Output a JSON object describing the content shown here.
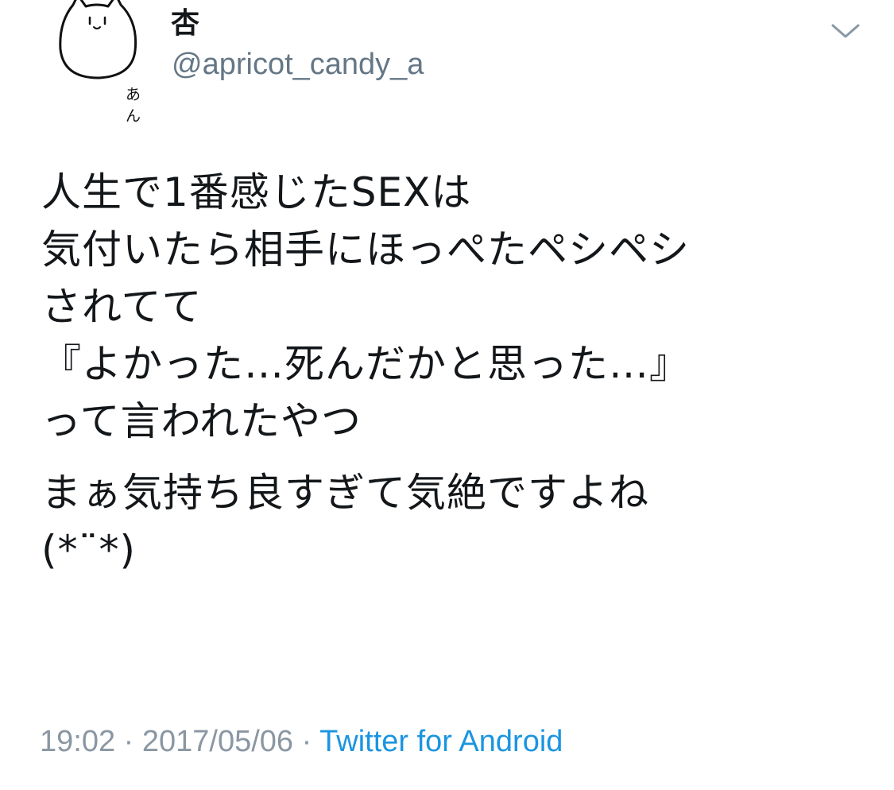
{
  "user": {
    "display_name": "杏",
    "handle": "@apricot_candy_a",
    "avatar_caption": "あん",
    "avatar_icon": "cat-doodle-icon"
  },
  "menu": {
    "icon": "chevron-down-icon"
  },
  "tweet": {
    "lines": [
      "人生で1番感じたSEXは",
      "気付いたら相手にほっぺたペシペシ",
      "されてて",
      "『よかった…死んだかと思った…』",
      "って言われたやつ",
      "まぁ気持ち良すぎて気絶ですよね",
      "(*¨*)"
    ]
  },
  "meta": {
    "time": "19:02",
    "separator": "·",
    "date": "2017/05/06",
    "source": "Twitter for Android"
  },
  "colors": {
    "text": "#14171a",
    "secondary": "#657786",
    "link": "#1b95e0"
  }
}
